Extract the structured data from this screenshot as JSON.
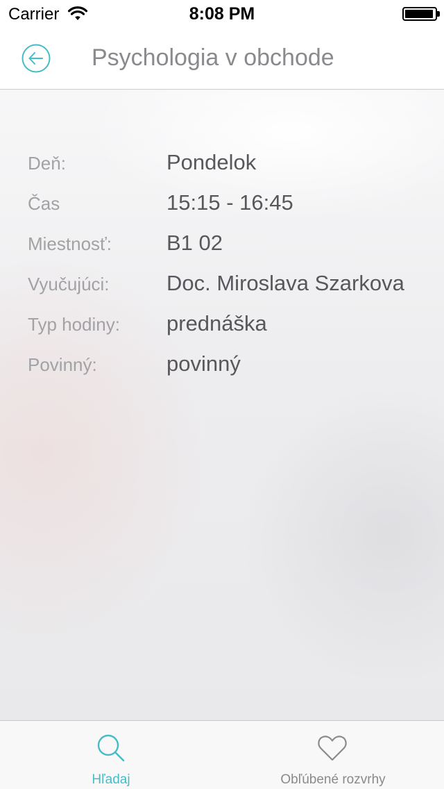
{
  "status_bar": {
    "carrier": "Carrier",
    "time": "8:08 PM",
    "battery_level": 0.95
  },
  "nav": {
    "title": "Psychologia v obchode",
    "back_icon": "arrow-left-circle-icon",
    "accent_color": "#46bcc6"
  },
  "details": [
    {
      "label": "Deň:",
      "value": "Pondelok"
    },
    {
      "label": "Čas",
      "value": "15:15 - 16:45"
    },
    {
      "label": "Miestnosť:",
      "value": "B1 02"
    },
    {
      "label": "Vyučujúci:",
      "value": "Doc. Miroslava Szarkova"
    },
    {
      "label": "Typ hodiny:",
      "value": "prednáška"
    },
    {
      "label": "Povinný:",
      "value": "povinný"
    }
  ],
  "tabs": [
    {
      "label": "Hľadaj",
      "icon": "search-icon",
      "selected": true
    },
    {
      "label": "Obľúbené rozvrhy",
      "icon": "heart-icon",
      "selected": false
    }
  ]
}
